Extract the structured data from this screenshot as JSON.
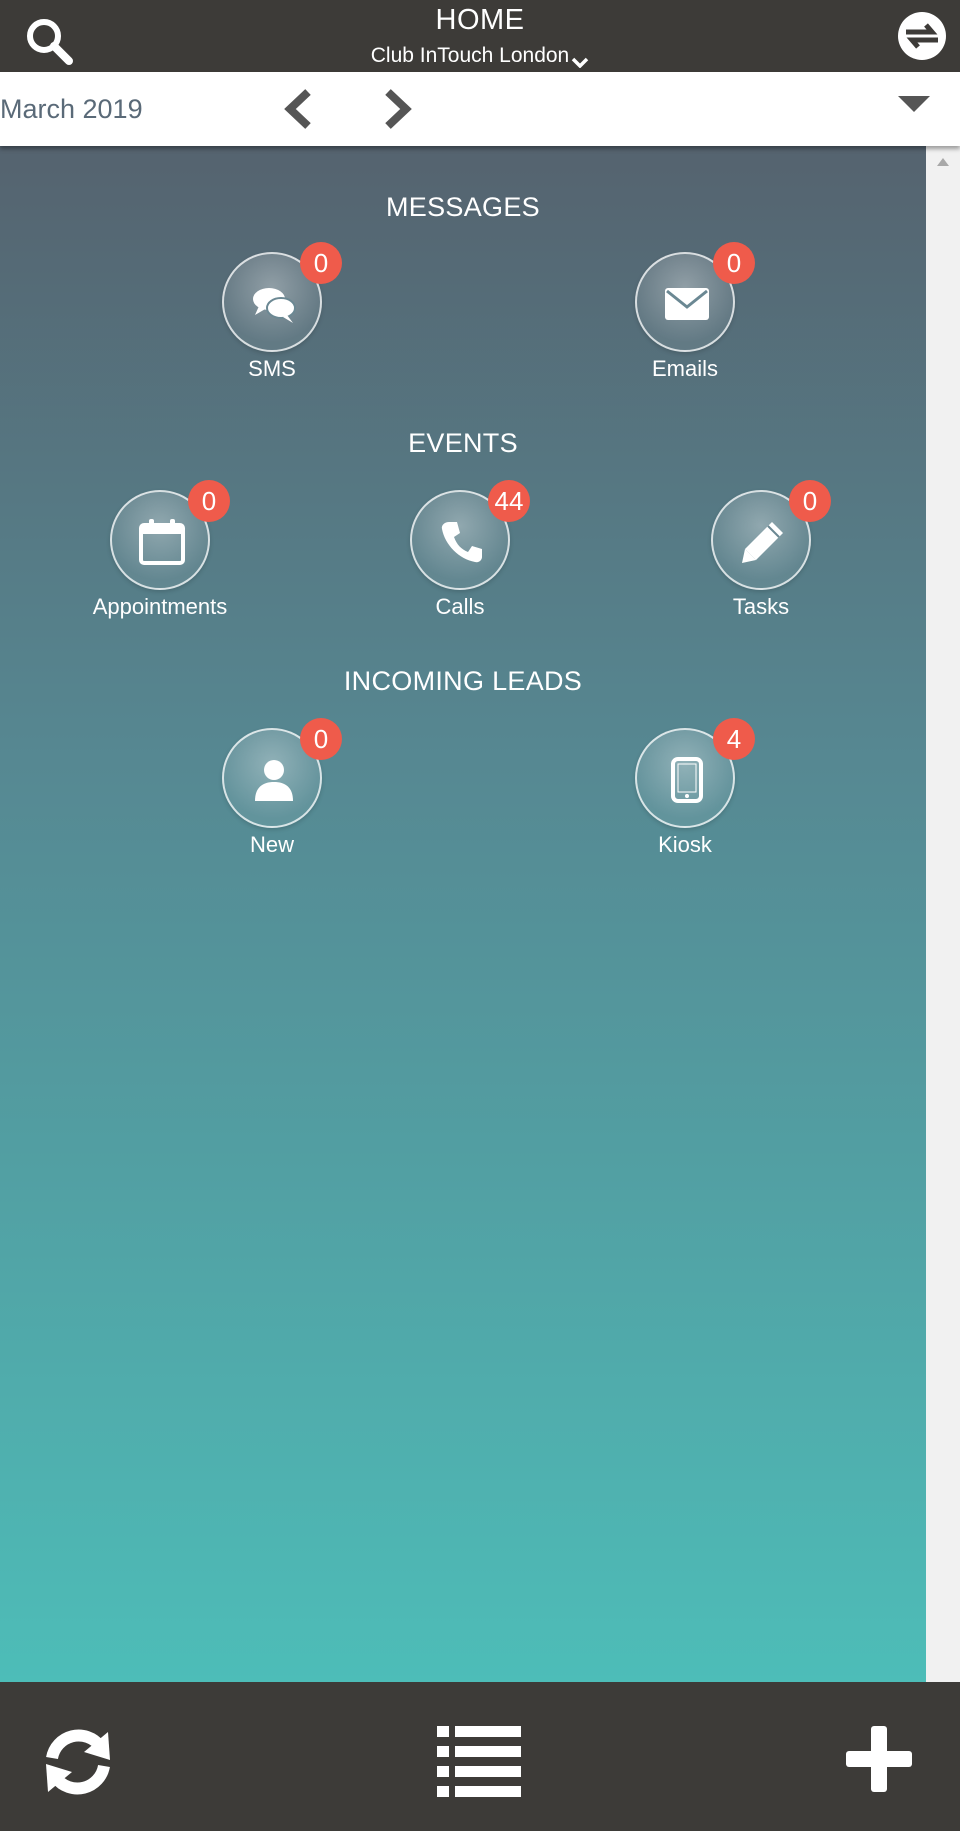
{
  "header": {
    "title": "HOME",
    "club": "Club InTouch London",
    "icons": {
      "left": "search-icon",
      "right": "sync-icon"
    }
  },
  "datebar": {
    "month": "March 2019",
    "icons": {
      "prev": "chevron-left-icon",
      "next": "chevron-right-icon",
      "dropdown": "caret-down-icon"
    }
  },
  "sections": {
    "messages": {
      "title": "MESSAGES",
      "items": [
        {
          "label": "SMS",
          "count": "0",
          "icon": "chat-bubbles-icon"
        },
        {
          "label": "Emails",
          "count": "0",
          "icon": "envelope-icon"
        }
      ]
    },
    "events": {
      "title": "EVENTS",
      "items": [
        {
          "label": "Appointments",
          "count": "0",
          "icon": "calendar-icon"
        },
        {
          "label": "Calls",
          "count": "44",
          "icon": "phone-icon"
        },
        {
          "label": "Tasks",
          "count": "0",
          "icon": "pencil-icon"
        }
      ]
    },
    "leads": {
      "title": "INCOMING LEADS",
      "items": [
        {
          "label": "New",
          "count": "0",
          "icon": "user-icon"
        },
        {
          "label": "Kiosk",
          "count": "4",
          "icon": "tablet-icon"
        }
      ]
    }
  },
  "footer": {
    "icons": {
      "left": "refresh-icon",
      "center": "list-icon",
      "right": "plus-icon"
    }
  },
  "colors": {
    "bar": "#3d3b38",
    "badge": "#ef5b4b",
    "gradient_top": "#55636f",
    "gradient_bottom": "#4dbdb8"
  }
}
